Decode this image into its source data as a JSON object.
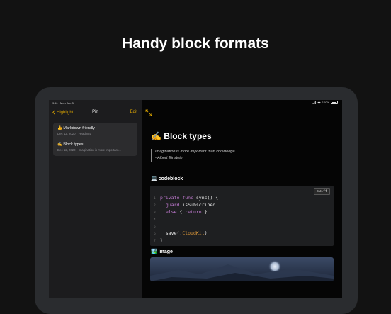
{
  "headline": "Handy block formats",
  "status_bar": {
    "time": "9:41",
    "date": "Mon Jun 3",
    "battery": "100%"
  },
  "nav": {
    "back_label": "Highlight",
    "title": "Pin",
    "edit_label": "Edit"
  },
  "notes": [
    {
      "title": "👍 Markdown friendly",
      "date": "Dec 12, 2020",
      "preview": "Heading1"
    },
    {
      "title": "✍️ Block types",
      "date": "Dec 12, 2020",
      "preview": "Imagination is more important..."
    }
  ],
  "document": {
    "title": "✍️ Block types",
    "quote_lines": [
      "Imagination is more important than knowledge.",
      "- Albert Einstein"
    ],
    "codeblock_heading": "💻 codeblock",
    "code_language": "swift",
    "code_line_numbers": [
      "1",
      "2",
      "3",
      "4",
      "5",
      "6",
      "7"
    ],
    "image_heading": "🏞️ image"
  },
  "colors": {
    "accent": "#e0a800",
    "background": "#121212",
    "sidebar": "#1c1c1e",
    "code_bg": "#1e1f21"
  }
}
